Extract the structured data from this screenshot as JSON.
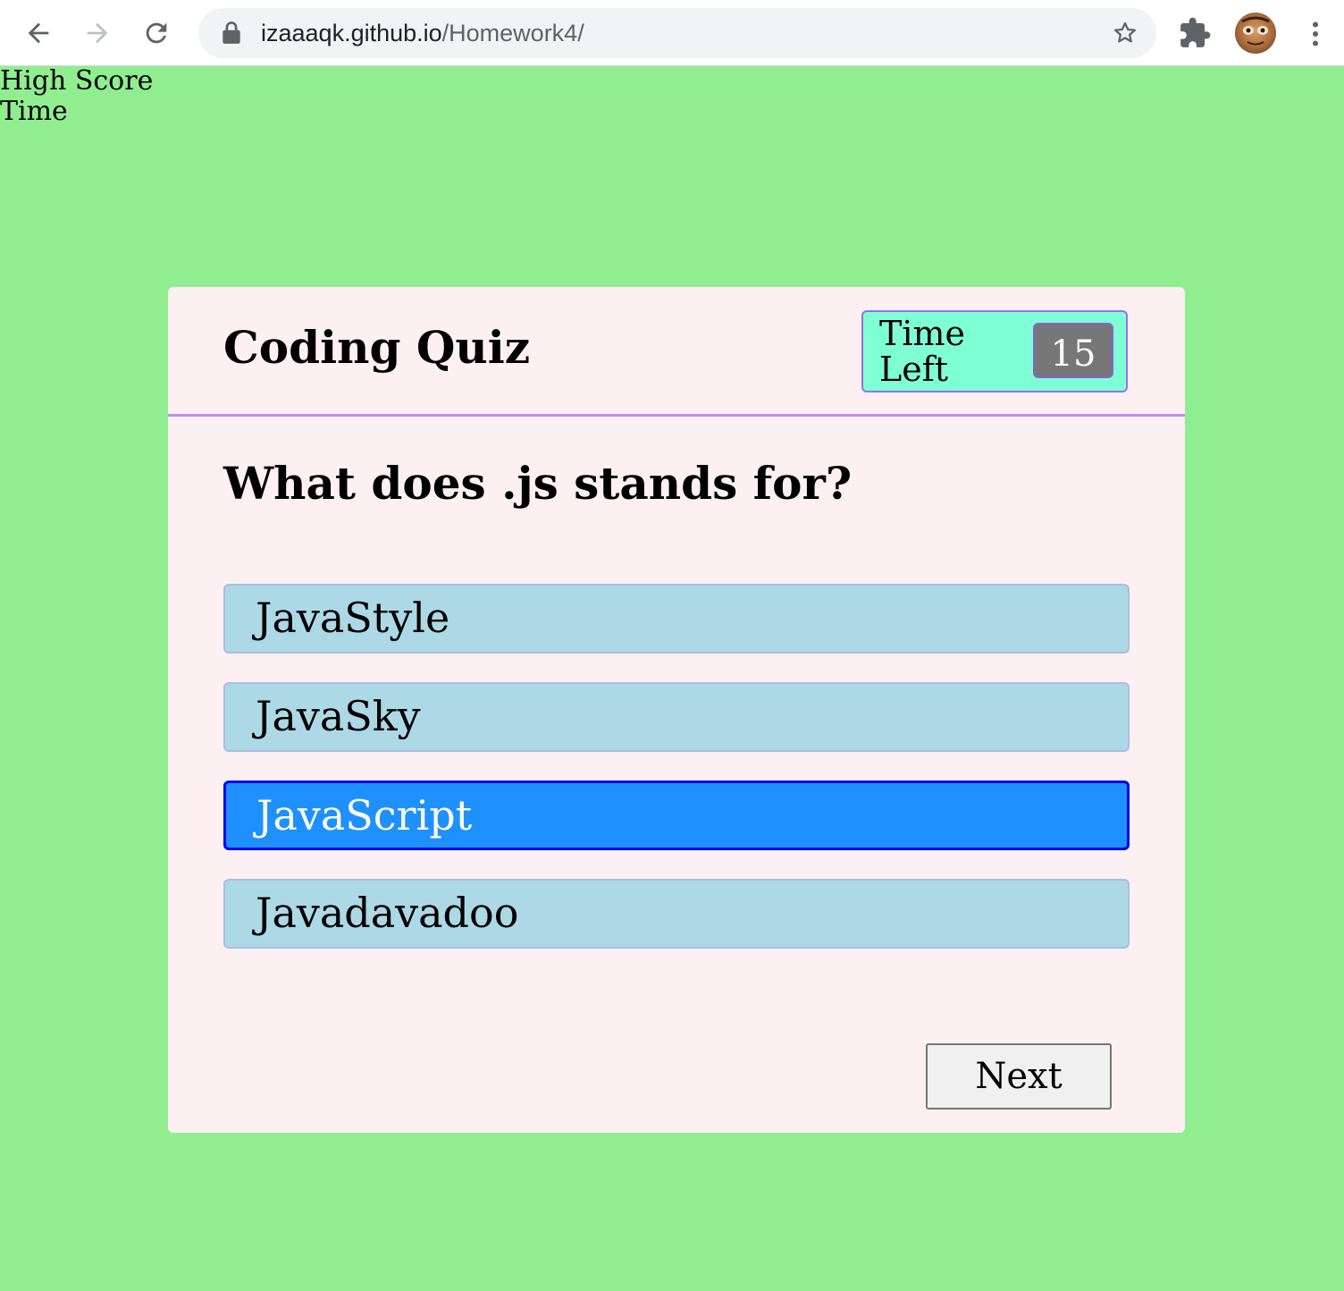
{
  "browser": {
    "url_host": "izaaaqk.github.io",
    "url_path": "/Homework4/",
    "icons": {
      "back": "arrow-left-icon",
      "forward": "arrow-right-icon",
      "reload": "reload-icon",
      "lock": "lock-icon",
      "bookmark": "star-icon",
      "extensions": "puzzle-icon",
      "profile": "avatar",
      "menu": "kebab-menu-icon"
    }
  },
  "page": {
    "high_score_label": "High Score",
    "time_label": "Time"
  },
  "quiz": {
    "title": "Coding Quiz",
    "timer": {
      "label": "Time Left",
      "value": "15"
    },
    "question": "What does .js stands for?",
    "answers": [
      {
        "label": "JavaStyle",
        "selected": false
      },
      {
        "label": "JavaSky",
        "selected": false
      },
      {
        "label": "JavaScript",
        "selected": true
      },
      {
        "label": "Javadavadoo",
        "selected": false
      }
    ],
    "next_label": "Next"
  },
  "colors": {
    "page_background": "#90ee90",
    "card_background": "#fcf0f3",
    "header_divider": "#c08ef0",
    "timer_background": "#7fffd4",
    "timer_value_background": "#777777",
    "answer_background": "#add8e6",
    "answer_selected_background": "#1e90ff",
    "answer_selected_border": "#0000ee"
  }
}
